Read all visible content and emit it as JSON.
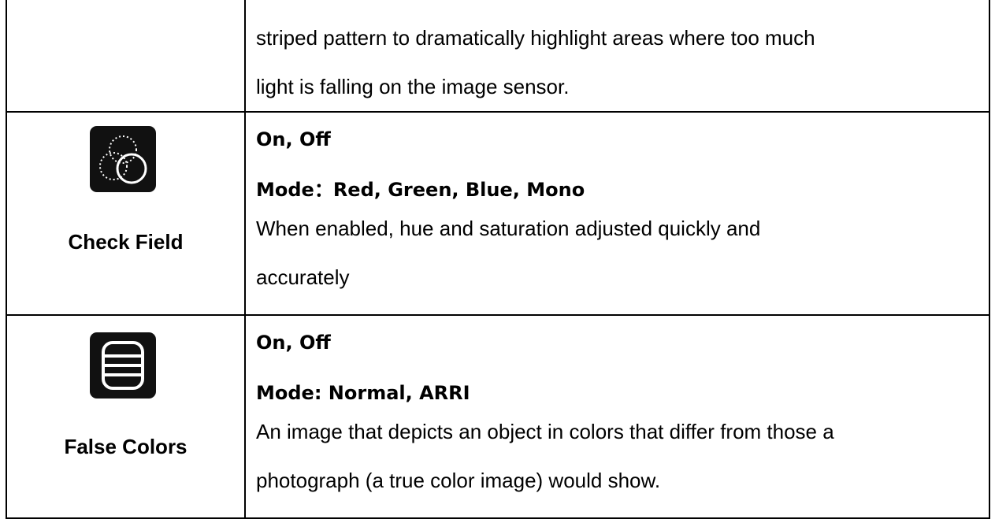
{
  "intro": {
    "text_line_1": "striped pattern to dramatically highlight areas where too much",
    "text_line_2": "light is falling on the image sensor."
  },
  "check_field": {
    "icon": "overlapping-circles-icon",
    "name": "Check Field",
    "options": "On, Off",
    "mode": "Mode：Red, Green, Blue, Mono",
    "description_line_1": "When enabled, hue and saturation adjusted quickly and",
    "description_line_2": "accurately"
  },
  "false_colors": {
    "icon": "horizontal-bars-icon",
    "name": "False Colors",
    "options": "On, Off",
    "mode": "Mode: Normal, ARRI",
    "description_line_1": "An image that depicts an object in colors that differ from those a",
    "description_line_2": "photograph (a true color image) would show."
  },
  "colors": {
    "border": "#000000",
    "icon_background": "#111111",
    "icon_stroke": "#ffffff"
  }
}
